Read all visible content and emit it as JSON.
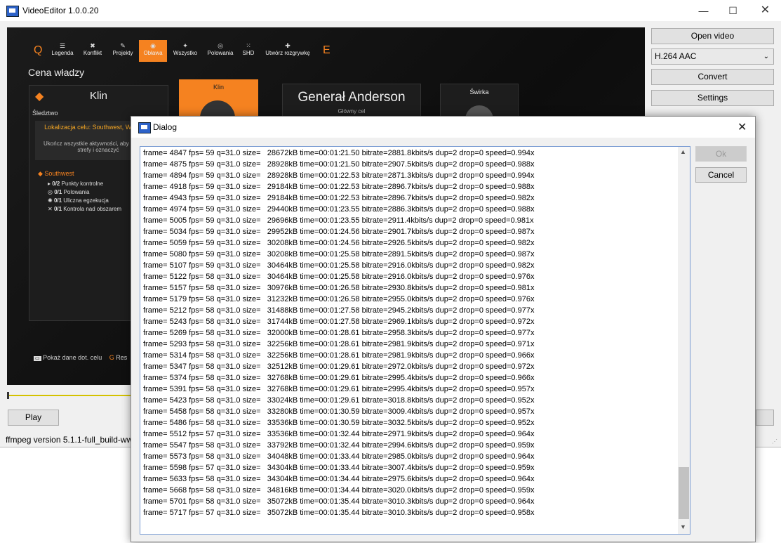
{
  "main": {
    "title": "VideoEditor 1.0.0.20",
    "open_label": "Open video",
    "codec_value": "H.264 AAC",
    "convert_label": "Convert",
    "settings_label": "Settings",
    "play_label": "Play",
    "status_text": "ffmpeg version 5.1.1-full_build-ww"
  },
  "game": {
    "nav": [
      {
        "icon": "☰",
        "label": "Legenda"
      },
      {
        "icon": "✖",
        "label": "Konflikt"
      },
      {
        "icon": "✎",
        "label": "Projekty"
      },
      {
        "icon": "◉",
        "label": "Obława"
      },
      {
        "icon": "✦",
        "label": "Wszystko"
      },
      {
        "icon": "◎",
        "label": "Polowania"
      },
      {
        "icon": "⁙",
        "label": "SHD"
      },
      {
        "icon": "✚",
        "label": "Utwórz rozgrywkę"
      }
    ],
    "key_q": "Q",
    "key_e": "E",
    "heading": "Cena władzy",
    "card_title": "Klin",
    "section": "Śledztwo",
    "location": "Lokalizacja celu: Southwest, Was D.C.",
    "desc": "Ukończ wszystkie aktywności, aby nazwane strefy i oznaczyć",
    "region": "Southwest",
    "tasks": [
      {
        "count": "0/2",
        "name": "Punkty kontrolne"
      },
      {
        "count": "0/1",
        "name": "Polowania"
      },
      {
        "count": "0/1",
        "name": "Uliczna egzekucja"
      },
      {
        "count": "0/1",
        "name": "Kontrola nad obszarem"
      }
    ],
    "portrait1": "Klin",
    "general_name": "Generał Anderson",
    "general_sub": "Główny cel",
    "portrait3": "Świrka",
    "footer1": "Pokaż dane dot. celu",
    "footer_key": "G",
    "footer2": "Res"
  },
  "dialog": {
    "title": "Dialog",
    "ok_label": "Ok",
    "cancel_label": "Cancel",
    "lines": [
      "frame= 4847 fps= 59 q=31.0 size=   28672kB time=00:01:21.50 bitrate=2881.8kbits/s dup=2 drop=0 speed=0.994x",
      "frame= 4875 fps= 59 q=31.0 size=   28928kB time=00:01:21.50 bitrate=2907.5kbits/s dup=2 drop=0 speed=0.988x",
      "frame= 4894 fps= 59 q=31.0 size=   28928kB time=00:01:22.53 bitrate=2871.3kbits/s dup=2 drop=0 speed=0.994x",
      "frame= 4918 fps= 59 q=31.0 size=   29184kB time=00:01:22.53 bitrate=2896.7kbits/s dup=2 drop=0 speed=0.988x",
      "frame= 4943 fps= 59 q=31.0 size=   29184kB time=00:01:22.53 bitrate=2896.7kbits/s dup=2 drop=0 speed=0.982x",
      "frame= 4974 fps= 59 q=31.0 size=   29440kB time=00:01:23.55 bitrate=2886.3kbits/s dup=2 drop=0 speed=0.988x",
      "frame= 5005 fps= 59 q=31.0 size=   29696kB time=00:01:23.55 bitrate=2911.4kbits/s dup=2 drop=0 speed=0.981x",
      "frame= 5034 fps= 59 q=31.0 size=   29952kB time=00:01:24.56 bitrate=2901.7kbits/s dup=2 drop=0 speed=0.987x",
      "frame= 5059 fps= 59 q=31.0 size=   30208kB time=00:01:24.56 bitrate=2926.5kbits/s dup=2 drop=0 speed=0.982x",
      "frame= 5080 fps= 59 q=31.0 size=   30208kB time=00:01:25.58 bitrate=2891.5kbits/s dup=2 drop=0 speed=0.987x",
      "frame= 5107 fps= 59 q=31.0 size=   30464kB time=00:01:25.58 bitrate=2916.0kbits/s dup=2 drop=0 speed=0.982x",
      "frame= 5122 fps= 58 q=31.0 size=   30464kB time=00:01:25.58 bitrate=2916.0kbits/s dup=2 drop=0 speed=0.976x",
      "frame= 5157 fps= 58 q=31.0 size=   30976kB time=00:01:26.58 bitrate=2930.8kbits/s dup=2 drop=0 speed=0.981x",
      "frame= 5179 fps= 58 q=31.0 size=   31232kB time=00:01:26.58 bitrate=2955.0kbits/s dup=2 drop=0 speed=0.976x",
      "frame= 5212 fps= 58 q=31.0 size=   31488kB time=00:01:27.58 bitrate=2945.2kbits/s dup=2 drop=0 speed=0.977x",
      "frame= 5243 fps= 58 q=31.0 size=   31744kB time=00:01:27.58 bitrate=2969.1kbits/s dup=2 drop=0 speed=0.972x",
      "frame= 5269 fps= 58 q=31.0 size=   32000kB time=00:01:28.61 bitrate=2958.3kbits/s dup=2 drop=0 speed=0.977x",
      "frame= 5293 fps= 58 q=31.0 size=   32256kB time=00:01:28.61 bitrate=2981.9kbits/s dup=2 drop=0 speed=0.971x",
      "frame= 5314 fps= 58 q=31.0 size=   32256kB time=00:01:28.61 bitrate=2981.9kbits/s dup=2 drop=0 speed=0.966x",
      "frame= 5347 fps= 58 q=31.0 size=   32512kB time=00:01:29.61 bitrate=2972.0kbits/s dup=2 drop=0 speed=0.972x",
      "frame= 5374 fps= 58 q=31.0 size=   32768kB time=00:01:29.61 bitrate=2995.4kbits/s dup=2 drop=0 speed=0.966x",
      "frame= 5391 fps= 58 q=31.0 size=   32768kB time=00:01:29.61 bitrate=2995.4kbits/s dup=2 drop=0 speed=0.957x",
      "frame= 5423 fps= 58 q=31.0 size=   33024kB time=00:01:29.61 bitrate=3018.8kbits/s dup=2 drop=0 speed=0.952x",
      "frame= 5458 fps= 58 q=31.0 size=   33280kB time=00:01:30.59 bitrate=3009.4kbits/s dup=2 drop=0 speed=0.957x",
      "frame= 5486 fps= 58 q=31.0 size=   33536kB time=00:01:30.59 bitrate=3032.5kbits/s dup=2 drop=0 speed=0.952x",
      "frame= 5512 fps= 57 q=31.0 size=   33536kB time=00:01:32.44 bitrate=2971.9kbits/s dup=2 drop=0 speed=0.964x",
      "frame= 5547 fps= 58 q=31.0 size=   33792kB time=00:01:32.44 bitrate=2994.6kbits/s dup=2 drop=0 speed=0.959x",
      "frame= 5573 fps= 58 q=31.0 size=   34048kB time=00:01:33.44 bitrate=2985.0kbits/s dup=2 drop=0 speed=0.964x",
      "frame= 5598 fps= 57 q=31.0 size=   34304kB time=00:01:33.44 bitrate=3007.4kbits/s dup=2 drop=0 speed=0.959x",
      "frame= 5633 fps= 58 q=31.0 size=   34304kB time=00:01:34.44 bitrate=2975.6kbits/s dup=2 drop=0 speed=0.964x",
      "frame= 5668 fps= 58 q=31.0 size=   34816kB time=00:01:34.44 bitrate=3020.0kbits/s dup=2 drop=0 speed=0.959x",
      "frame= 5701 fps= 58 q=31.0 size=   35072kB time=00:01:35.44 bitrate=3010.3kbits/s dup=2 drop=0 speed=0.964x",
      "frame= 5717 fps= 57 q=31.0 size=   35072kB time=00:01:35.44 bitrate=3010.3kbits/s dup=2 drop=0 speed=0.958x"
    ]
  }
}
